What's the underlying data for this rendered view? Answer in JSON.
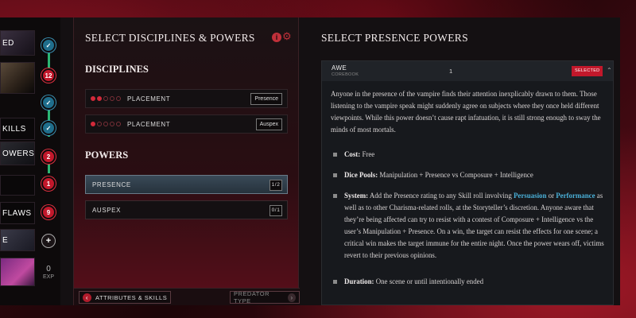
{
  "left_strip": {
    "thumbs": [
      "ED",
      "",
      "KILLS",
      "OWERS",
      "",
      "FLAWS",
      "E",
      ""
    ],
    "nodes": [
      "✓",
      "12",
      "✓",
      "✓",
      "2",
      "1",
      "9",
      "+"
    ],
    "exp_value": "0",
    "exp_label": "EXP"
  },
  "middle": {
    "title": "SELECT DISCIPLINES & POWERS",
    "disciplines_title": "DISCIPLINES",
    "disciplines": [
      {
        "label": "PLACEMENT",
        "filled": 2,
        "total": 5,
        "tag": "Presence"
      },
      {
        "label": "PLACEMENT",
        "filled": 1,
        "total": 5,
        "tag": "Auspex"
      }
    ],
    "powers_title": "POWERS",
    "powers": [
      {
        "label": "PRESENCE",
        "count": "1/2"
      },
      {
        "label": "AUSPEX",
        "count": "0/1"
      }
    ],
    "prev_label": "ATTRIBUTES & SKILLS",
    "next_label": "PREDATOR TYPE"
  },
  "right": {
    "title": "SELECT PRESENCE POWERS",
    "card": {
      "name": "AWE",
      "source": "COREBOOK",
      "level": "1",
      "badge": "SELECTED",
      "description": "Anyone in the presence of the vampire finds their attention inexplicably drawn to them. Those listening to the vampire speak might suddenly agree on subjects where they once held different viewpoints. While this power doesn’t cause rapt infatuation, it is still strong enough to sway the minds of most mortals.",
      "cost_label": "Cost:",
      "cost_value": "Free",
      "dice_label": "Dice Pools:",
      "dice_value": "Manipulation + Presence vs Composure + Intelligence",
      "system_label": "System:",
      "system_text_1": "Add the Presence rating to any Skill roll involving",
      "system_kw_1": "Persuasion",
      "system_text_2": "or",
      "system_kw_2": "Performance",
      "system_text_3": "as well as to other Charisma-related rolls, at the Storyteller’s discretion. Anyone aware that they’re being affected can try to resist with a contest of Composure + Intelligence vs the user’s Manipulation + Presence. On a win, the target can resist the effects for one scene; a critical win makes the target immune for the entire night. Once the power wears off, victims revert to their previous opinions.",
      "duration_label": "Duration:",
      "duration_value": "One scene or until intentionally ended"
    }
  }
}
